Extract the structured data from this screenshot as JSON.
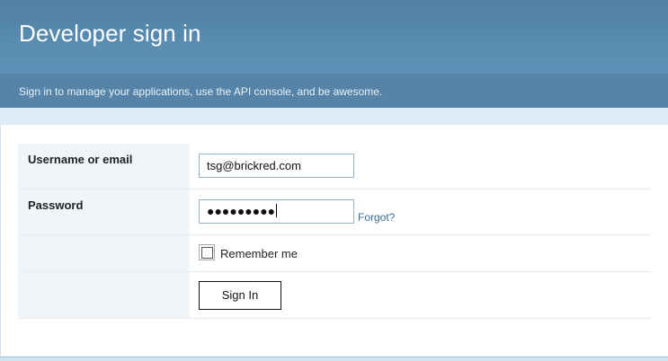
{
  "header": {
    "title": "Developer sign in",
    "subtitle": "Sign in to manage your applications, use the API console, and be awesome."
  },
  "form": {
    "username": {
      "label": "Username or email",
      "value": "tsg@brickred.com"
    },
    "password": {
      "label": "Password",
      "masked_value": "●●●●●●●●●",
      "forgot_link": "Forgot?"
    },
    "remember": {
      "label": "Remember me",
      "checked": false
    },
    "submit_label": "Sign In"
  },
  "colors": {
    "header_bg": "#5a8db2",
    "subheader_bg": "#5584a8",
    "band_bg": "#deedf5",
    "label_cell_bg": "#eff5f9",
    "link": "#3a6f9a"
  }
}
